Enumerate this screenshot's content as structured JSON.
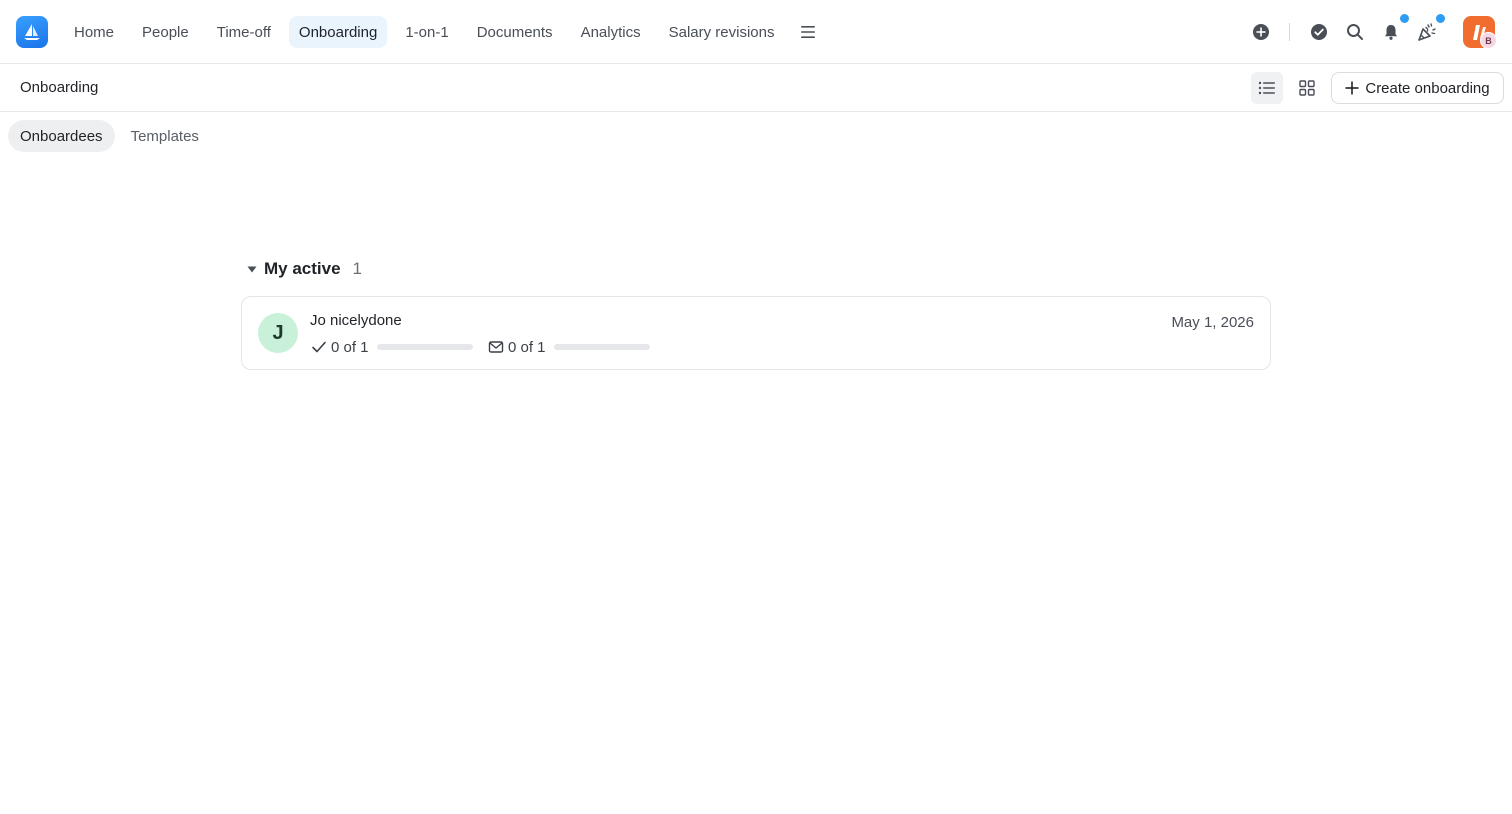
{
  "nav": {
    "items": [
      {
        "label": "Home"
      },
      {
        "label": "People"
      },
      {
        "label": "Time-off"
      },
      {
        "label": "Onboarding",
        "active": true
      },
      {
        "label": "1-on-1"
      },
      {
        "label": "Documents"
      },
      {
        "label": "Analytics"
      },
      {
        "label": "Salary revisions"
      }
    ],
    "icons": [
      "plus-circle-icon",
      "check-circle-icon",
      "search-icon",
      "bell-icon",
      "party-icon"
    ],
    "user_initial": "B",
    "notification_dot_color": "#2d9cf4"
  },
  "subheader": {
    "title": "Onboarding",
    "create_label": "Create onboarding"
  },
  "tabs": [
    {
      "label": "Onboardees",
      "active": true
    },
    {
      "label": "Templates"
    }
  ],
  "section": {
    "title": "My active",
    "count": "1"
  },
  "onboardees": [
    {
      "initial": "J",
      "name": "Jo nicelydone",
      "tasks_text": "0 of 1",
      "tasks_progress": 0,
      "messages_text": "0 of 1",
      "messages_progress": 0,
      "date": "May 1, 2026"
    }
  ],
  "colors": {
    "accent": "#2d9cf4",
    "active_nav_bg": "#eaf4fc",
    "avatar_bg": "#c9f0d9",
    "brand_orange": "#f06d2f"
  }
}
